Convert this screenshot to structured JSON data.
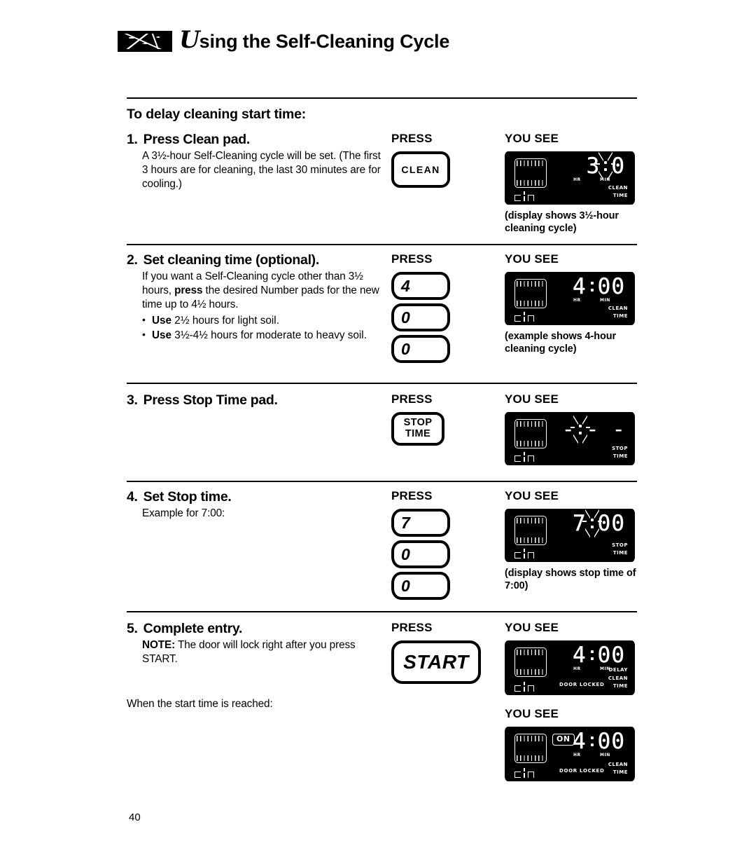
{
  "header": {
    "title_initial": "U",
    "title_rest": "sing the Self-Cleaning Cycle",
    "brush_icon": "brush-stroke-mark"
  },
  "section_heading": "To delay cleaning start time:",
  "column_labels": {
    "press": "PRESS",
    "you_see": "YOU SEE"
  },
  "steps": [
    {
      "num": "1.",
      "title": "Press Clean pad.",
      "body": "A 3½-hour Self-Cleaning cycle will be set. (The first 3 hours are for cleaning, the last 30 minutes are for cooling.)",
      "pads": [
        {
          "type": "clean",
          "label": "CLEAN"
        }
      ],
      "display": {
        "time": "3:30",
        "digits": [
          "3",
          "0"
        ],
        "colon": "flashing",
        "hr_label": "HR",
        "min_label": "MIN",
        "indicators": "CLEAN\nTIME",
        "seg_word": "cl n",
        "vent_icon": "oven-element-icon"
      },
      "caption": "(display shows 3½-hour cleaning cycle)"
    },
    {
      "num": "2.",
      "title": "Set cleaning time (optional).",
      "body_parts": [
        "If you want a Self-Cleaning cycle other than 3½ hours, ",
        "press",
        " the desired Number pads for the new time up to 4½ hours."
      ],
      "bullets": [
        {
          "bold": "Use",
          "rest": " 2½ hours for light soil."
        },
        {
          "bold": "Use",
          "rest": " 3½-4½ hours for moderate to heavy soil."
        }
      ],
      "pads": [
        {
          "type": "num",
          "label": "4"
        },
        {
          "type": "num",
          "label": "0"
        },
        {
          "type": "num",
          "label": "0"
        }
      ],
      "display": {
        "time": "4:00",
        "digits": [
          "4",
          "00"
        ],
        "colon": "steady",
        "hr_label": "HR",
        "min_label": "MIN",
        "indicators": "CLEAN\nTIME",
        "seg_word": "cl n",
        "vent_icon": "oven-element-icon"
      },
      "caption": "(example shows 4-hour cleaning cycle)"
    },
    {
      "num": "3.",
      "title": "Press Stop Time pad.",
      "pads": [
        {
          "type": "stop",
          "line1": "STOP",
          "line2": "TIME"
        }
      ],
      "display": {
        "time": "-:- -",
        "digits": [
          "-",
          "- -"
        ],
        "colon": "flashing",
        "indicators": "STOP\nTIME",
        "seg_word": "cl n",
        "vent_icon": "oven-element-icon"
      }
    },
    {
      "num": "4.",
      "title": "Set Stop time.",
      "body": "Example for 7:00:",
      "pads": [
        {
          "type": "num",
          "label": "7"
        },
        {
          "type": "num",
          "label": "0"
        },
        {
          "type": "num",
          "label": "0"
        }
      ],
      "display": {
        "time": "7:00",
        "digits": [
          "7",
          "00"
        ],
        "colon": "flashing",
        "indicators": "STOP\nTIME",
        "seg_word": "cl n",
        "vent_icon": "oven-element-icon"
      },
      "caption": "(display shows stop time of 7:00)"
    },
    {
      "num": "5.",
      "title": "Complete entry.",
      "note_bold": "NOTE:",
      "note_rest": " The door will lock right after you press START.",
      "follow_up": "When the start time is reached:",
      "pads": [
        {
          "type": "start",
          "label": "START"
        }
      ],
      "display": {
        "time": "4:00",
        "digits": [
          "4",
          "00"
        ],
        "colon": "steady",
        "hr_label": "HR",
        "min_label": "MIN",
        "indicators": "DELAY\nCLEAN\nTIME",
        "door_locked": "DOOR LOCKED",
        "seg_word": "cl n",
        "vent_icon": "oven-element-icon"
      },
      "display2_label": "YOU SEE",
      "display2": {
        "time": "4:00",
        "digits": [
          "4",
          "00"
        ],
        "colon": "steady",
        "hr_label": "HR",
        "min_label": "MIN",
        "indicators": "CLEAN\nTIME",
        "door_locked": "DOOR LOCKED",
        "on_badge": "ON",
        "seg_word": "cl n",
        "vent_icon": "oven-element-icon"
      }
    }
  ],
  "page_number": "40"
}
